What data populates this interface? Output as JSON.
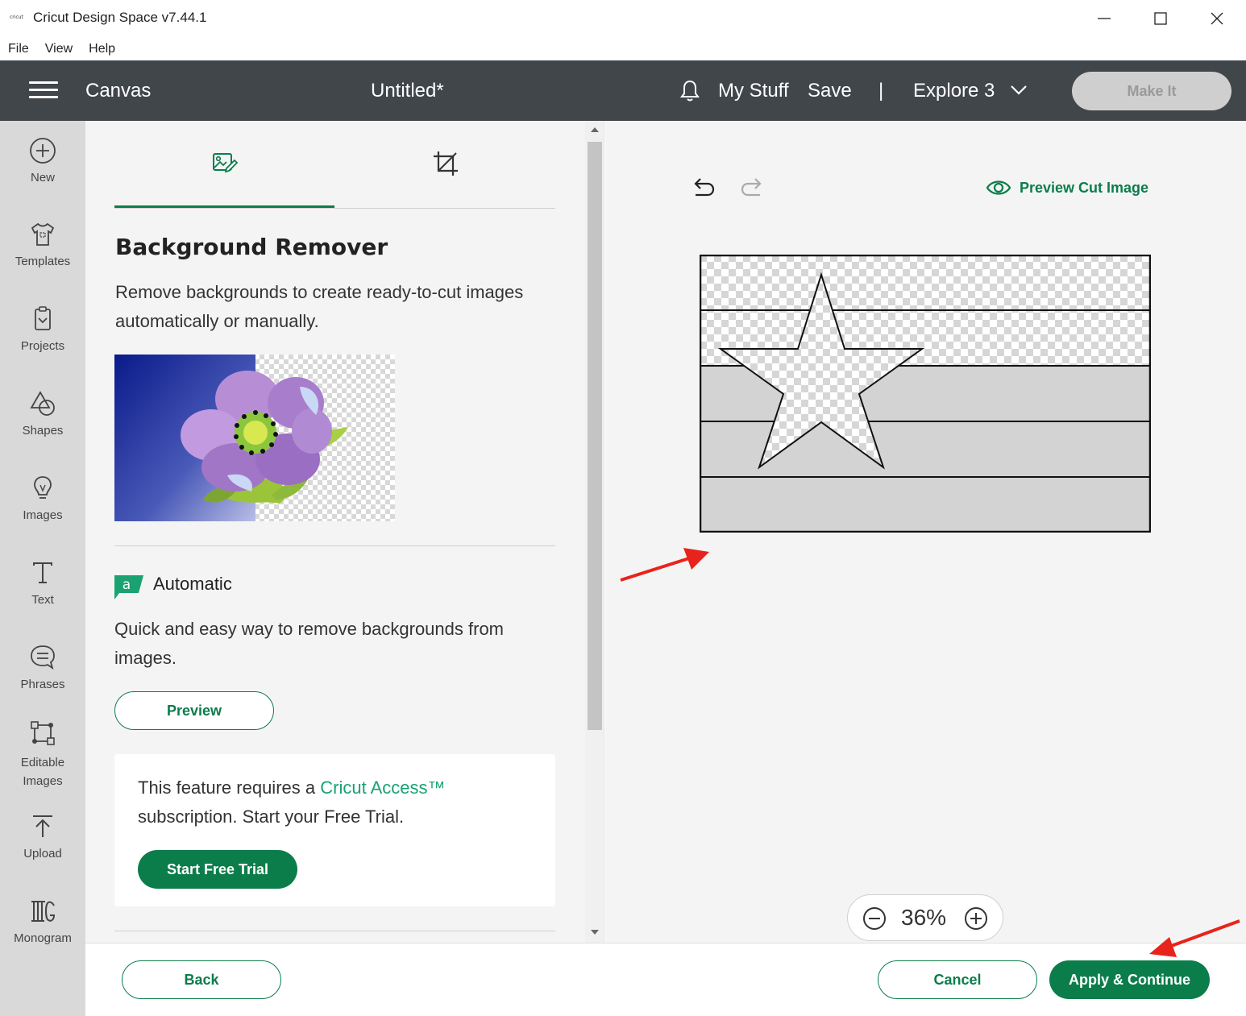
{
  "window": {
    "app_logo_text": "cricut",
    "title": "Cricut Design Space  v7.44.1"
  },
  "menu": [
    "File",
    "View",
    "Help"
  ],
  "header": {
    "section": "Canvas",
    "document_title": "Untitled*",
    "my_stuff": "My Stuff",
    "save": "Save",
    "separator": "|",
    "machine": "Explore 3",
    "make_it": "Make It"
  },
  "sidebar": {
    "items": [
      {
        "label": "New",
        "icon": "plus-circle-icon"
      },
      {
        "label": "Templates",
        "icon": "shirt-icon"
      },
      {
        "label": "Projects",
        "icon": "projects-icon"
      },
      {
        "label": "Shapes",
        "icon": "shapes-icon"
      },
      {
        "label": "Images",
        "icon": "lightbulb-icon"
      },
      {
        "label": "Text",
        "icon": "text-icon"
      },
      {
        "label": "Phrases",
        "icon": "speech-bubble-icon"
      },
      {
        "label": "Editable Images",
        "icon": "editable-images-icon"
      },
      {
        "label": "Upload",
        "icon": "upload-icon"
      },
      {
        "label": "Monogram",
        "icon": "monogram-icon"
      }
    ]
  },
  "panel": {
    "title": "Background Remover",
    "description": "Remove backgrounds to create ready-to-cut images automatically or manually.",
    "automatic": {
      "badge": "a",
      "title": "Automatic",
      "description": "Quick and easy way to remove backgrounds from images.",
      "preview_button": "Preview"
    },
    "access": {
      "text_before": "This feature requires a ",
      "link": "Cricut Access™",
      "text_after": " subscription. Start your Free Trial.",
      "trial_button": "Start Free Trial"
    }
  },
  "canvas": {
    "preview_cut": "Preview Cut Image",
    "zoom": "36%"
  },
  "footer": {
    "back": "Back",
    "cancel": "Cancel",
    "apply": "Apply & Continue"
  },
  "colors": {
    "brand_green": "#0b7d4b",
    "link_green": "#1aa273",
    "header_bg": "#41464b",
    "annotation_arrow": "#e8231b"
  }
}
